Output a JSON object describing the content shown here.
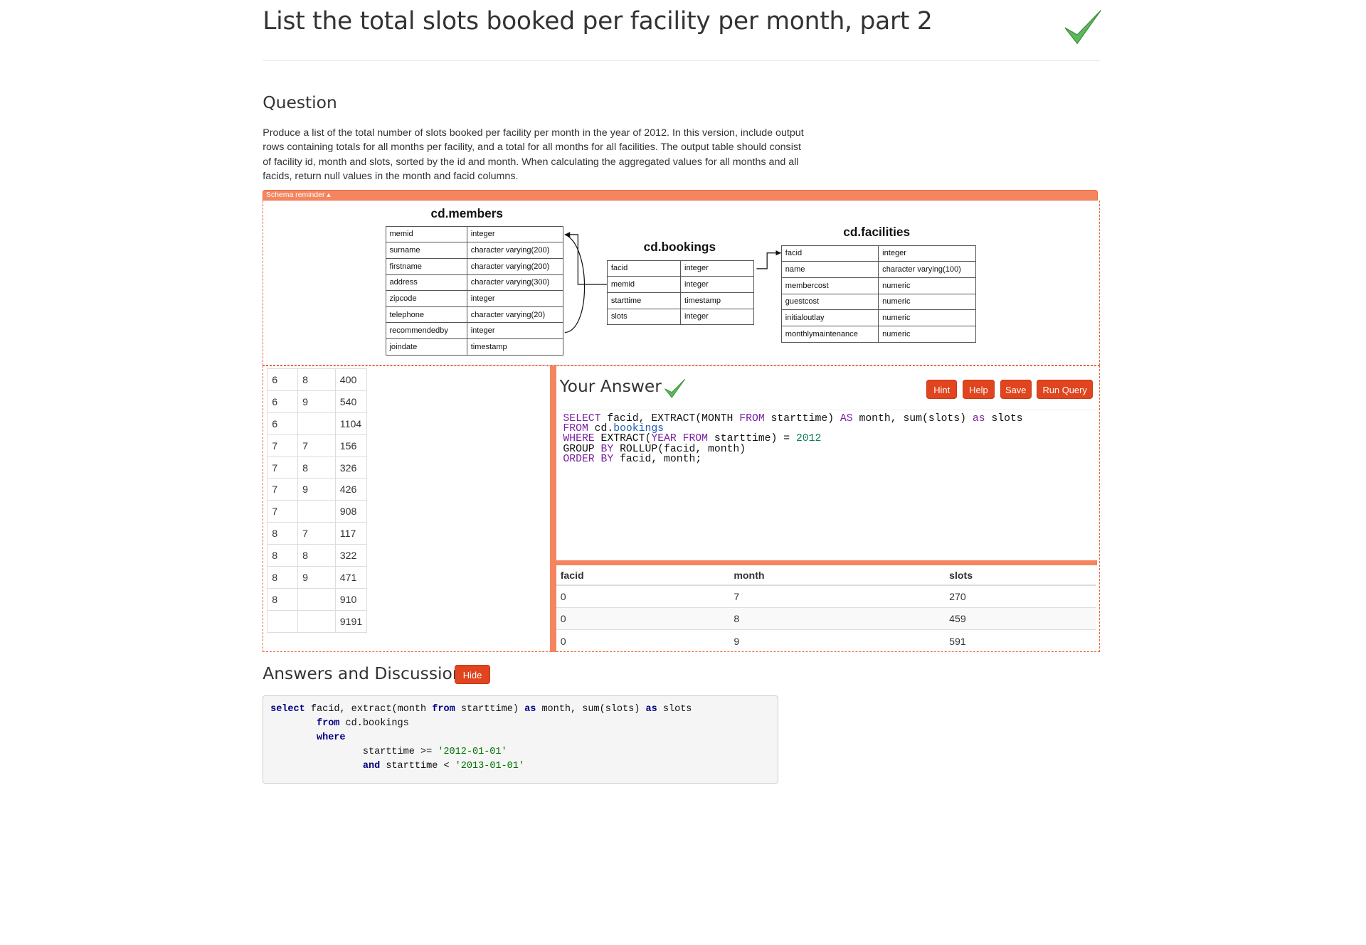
{
  "page": {
    "title": "List the total slots booked per facility per month, part 2",
    "question_heading": "Question",
    "question_text": "Produce a list of the total number of slots booked per facility per month in the year of 2012. In this version, include output rows containing totals for all months per facility, and a total for all months for all facilities. The output table should consist of facility id, month and slots, sorted by the id and month. When calculating the aggregated values for all months and all facids, return null values in the month and facid columns.",
    "schema_reminder": "Schema reminder ▴"
  },
  "schema": {
    "members": {
      "title": "cd.members",
      "rows": [
        [
          "memid",
          "integer"
        ],
        [
          "surname",
          "character varying(200)"
        ],
        [
          "firstname",
          "character varying(200)"
        ],
        [
          "address",
          "character varying(300)"
        ],
        [
          "zipcode",
          "integer"
        ],
        [
          "telephone",
          "character varying(20)"
        ],
        [
          "recommendedby",
          "integer"
        ],
        [
          "joindate",
          "timestamp"
        ]
      ]
    },
    "bookings": {
      "title": "cd.bookings",
      "rows": [
        [
          "facid",
          "integer"
        ],
        [
          "memid",
          "integer"
        ],
        [
          "starttime",
          "timestamp"
        ],
        [
          "slots",
          "integer"
        ]
      ]
    },
    "facilities": {
      "title": "cd.facilities",
      "rows": [
        [
          "facid",
          "integer"
        ],
        [
          "name",
          "character varying(100)"
        ],
        [
          "membercost",
          "numeric"
        ],
        [
          "guestcost",
          "numeric"
        ],
        [
          "initialoutlay",
          "numeric"
        ],
        [
          "monthlymaintenance",
          "numeric"
        ]
      ]
    }
  },
  "expected_results": [
    [
      "6",
      "8",
      "400"
    ],
    [
      "6",
      "9",
      "540"
    ],
    [
      "6",
      "",
      "1104"
    ],
    [
      "7",
      "7",
      "156"
    ],
    [
      "7",
      "8",
      "326"
    ],
    [
      "7",
      "9",
      "426"
    ],
    [
      "7",
      "",
      "908"
    ],
    [
      "8",
      "7",
      "117"
    ],
    [
      "8",
      "8",
      "322"
    ],
    [
      "8",
      "9",
      "471"
    ],
    [
      "8",
      "",
      "910"
    ],
    [
      "",
      "",
      "9191"
    ]
  ],
  "your_answer": {
    "heading": "Your Answer",
    "buttons": {
      "hint": "Hint",
      "help": "Help",
      "save": "Save",
      "run": "Run Query"
    },
    "code_lines": [
      "SELECT facid, EXTRACT(MONTH FROM starttime) AS month, sum(slots) as slots",
      "FROM cd.bookings",
      "WHERE EXTRACT(YEAR FROM starttime) = 2012",
      "GROUP BY ROLLUP(facid, month)",
      "ORDER BY facid, month;"
    ],
    "result_headers": [
      "facid",
      "month",
      "slots"
    ],
    "result_rows": [
      [
        "0",
        "7",
        "270"
      ],
      [
        "0",
        "8",
        "459"
      ],
      [
        "0",
        "9",
        "591"
      ]
    ]
  },
  "discussion": {
    "heading": "Answers and Discussion",
    "hide_label": "Hide",
    "code_lines": [
      "select facid, extract(month from starttime) as month, sum(slots) as slots",
      "        from cd.bookings",
      "        where",
      "                starttime >= '2012-01-01'",
      "                and starttime < '2013-01-01'"
    ]
  },
  "colors": {
    "accent": "#e0451f",
    "accent_light": "#f5855f",
    "check": "#4caf50"
  },
  "icons": {
    "title_check": "checkmark-icon",
    "answer_check": "checkmark-icon"
  }
}
